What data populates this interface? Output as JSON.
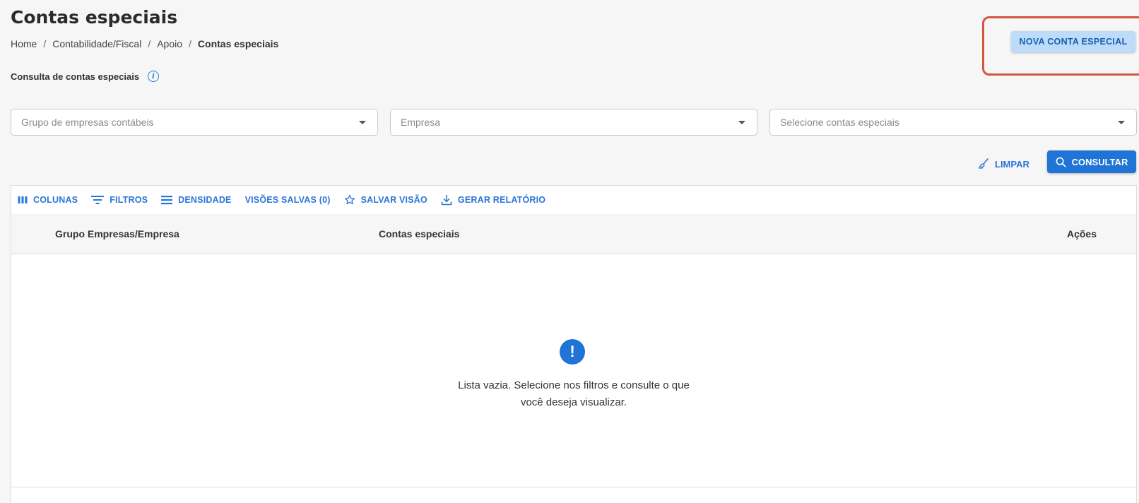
{
  "header": {
    "title": "Contas especiais",
    "breadcrumb": {
      "items": [
        "Home",
        "Contabilidade/Fiscal",
        "Apoio"
      ],
      "separator": "/",
      "current": "Contas especiais"
    },
    "new_button_label": "NOVA CONTA ESPECIAL"
  },
  "filters": {
    "section_title": "Consulta de contas especiais",
    "group_placeholder": "Grupo de empresas contábeis",
    "company_placeholder": "Empresa",
    "accounts_placeholder": "Selecione contas especiais",
    "clear_label": "LIMPAR",
    "search_label": "CONSULTAR"
  },
  "grid": {
    "toolbar": {
      "columns": "COLUNAS",
      "filters": "FILTROS",
      "density": "DENSIDADE",
      "saved_views": "VISÕES SALVAS (0)",
      "save_view": "SALVAR VISÃO",
      "report": "GERAR RELATÓRIO"
    },
    "columns": [
      "Grupo Empresas/Empresa",
      "Contas especiais",
      "Ações"
    ],
    "empty": {
      "line1": "Lista vazia. Selecione nos filtros e consulte o que",
      "line2": "você deseja visualizar."
    }
  },
  "colors": {
    "primary": "#1f74d6",
    "primary_light": "#bcdcfa",
    "highlight": "#d4553f",
    "background": "#f6f6f6"
  }
}
